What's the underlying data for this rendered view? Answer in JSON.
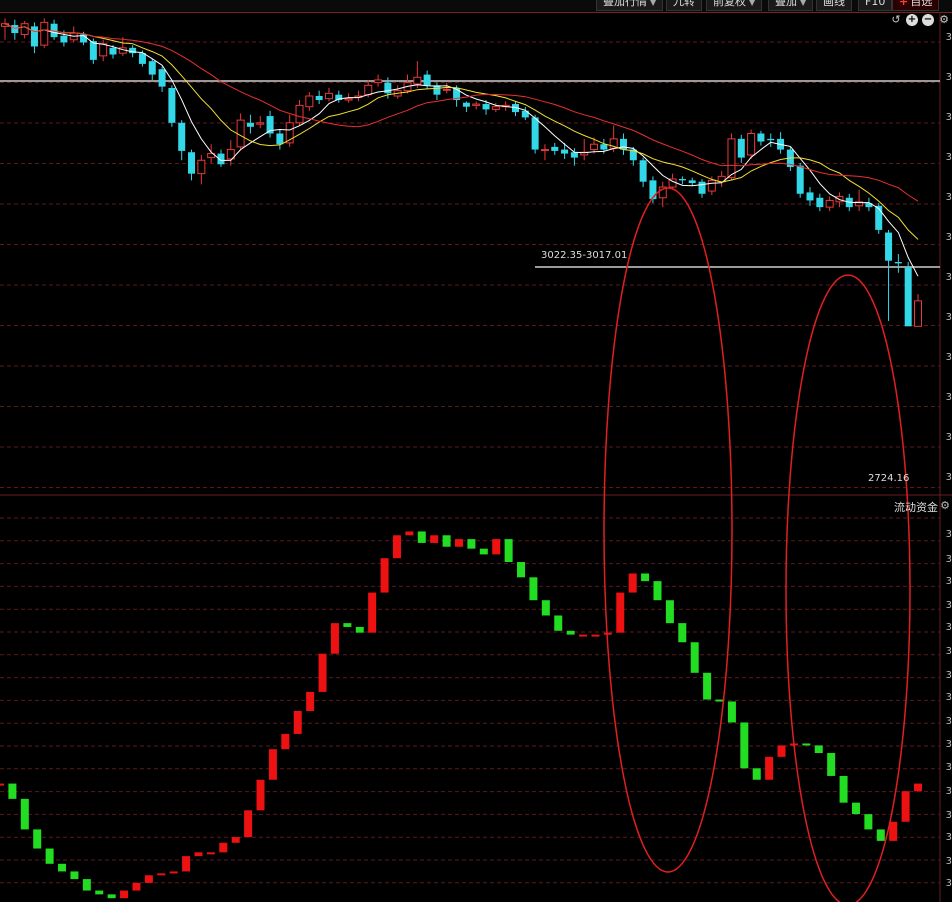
{
  "toolbar": {
    "items": [
      {
        "label": "叠加行情",
        "caret": true
      },
      {
        "label": "九转",
        "caret": false
      },
      {
        "label": "前复权",
        "caret": true
      },
      {
        "label": "叠加",
        "caret": true
      },
      {
        "label": "画线",
        "caret": false
      },
      {
        "label": "F10",
        "caret": false
      },
      {
        "label": "自选",
        "caret": false
      }
    ],
    "fav_plus": "+"
  },
  "chart_tools": {
    "undo": "↺",
    "zoom_in": "+",
    "zoom_out": "−",
    "settings": "⚙"
  },
  "annotations": {
    "range_label": "3022.35-3017.01",
    "low_label": "2724.16"
  },
  "lower_panel": {
    "title": "流动资金",
    "settings": "⚙"
  },
  "axis_tick_glyph": "3",
  "colors": {
    "up": "#e8393a",
    "down": "#33d8e8",
    "ma5": "#ffffff",
    "ma10": "#f2e030",
    "ma20": "#e83030",
    "flow_up": "#ee1111",
    "flow_down": "#22dd22",
    "grid": "#5a1a1a",
    "hline": "#9a9a9a",
    "ellipse": "#e02020"
  },
  "chart_data": [
    {
      "type": "candlestick",
      "title": "",
      "candles": [
        [
          3050,
          3052,
          3040,
          3056
        ],
        [
          3051,
          3045,
          3040,
          3055
        ],
        [
          3044,
          3052,
          3041,
          3054
        ],
        [
          3050,
          3035,
          3030,
          3053
        ],
        [
          3036,
          3053,
          3034,
          3056
        ],
        [
          3052,
          3042,
          3040,
          3055
        ],
        [
          3043,
          3038,
          3035,
          3047
        ],
        [
          3040,
          3045,
          3038,
          3050
        ],
        [
          3044,
          3038,
          3036,
          3046
        ],
        [
          3039,
          3025,
          3022,
          3041
        ],
        [
          3028,
          3037,
          3024,
          3040
        ],
        [
          3034,
          3029,
          3026,
          3036
        ],
        [
          3030,
          3034,
          3028,
          3042
        ],
        [
          3034,
          3030,
          3027,
          3036
        ],
        [
          3030,
          3022,
          3020,
          3032
        ],
        [
          3024,
          3014,
          3010,
          3026
        ],
        [
          3018,
          3005,
          3001,
          3020
        ],
        [
          3004,
          2978,
          2975,
          3006
        ],
        [
          2978,
          2957,
          2950,
          2980
        ],
        [
          2956,
          2940,
          2935,
          2958
        ],
        [
          2940,
          2950,
          2932,
          2954
        ],
        [
          2952,
          2955,
          2948,
          2962
        ],
        [
          2955,
          2947,
          2945,
          2958
        ],
        [
          2951,
          2958,
          2946,
          2965
        ],
        [
          2960,
          2980,
          2958,
          2985
        ],
        [
          2978,
          2975,
          2970,
          2984
        ],
        [
          2977,
          2978,
          2974,
          2983
        ],
        [
          2983,
          2970,
          2967,
          2987
        ],
        [
          2970,
          2962,
          2958,
          2973
        ],
        [
          2963,
          2978,
          2960,
          2984
        ],
        [
          2978,
          2991,
          2976,
          2995
        ],
        [
          2990,
          2998,
          2987,
          3001
        ],
        [
          2998,
          2995,
          2992,
          3002
        ],
        [
          2996,
          3000,
          2994,
          3004
        ],
        [
          2999,
          2995,
          2993,
          3002
        ],
        [
          2995,
          2996,
          2993,
          3000
        ],
        [
          2997,
          2998,
          2994,
          3002
        ],
        [
          2999,
          3006,
          2997,
          3010
        ],
        [
          3008,
          3010,
          3005,
          3014
        ],
        [
          3008,
          3000,
          2996,
          3012
        ],
        [
          2998,
          3002,
          2996,
          3006
        ],
        [
          3002,
          3008,
          3000,
          3014
        ],
        [
          3007,
          3012,
          3004,
          3024
        ],
        [
          3014,
          3006,
          3003,
          3017
        ],
        [
          3006,
          2999,
          2995,
          3008
        ],
        [
          3003,
          3003,
          3000,
          3008
        ],
        [
          3004,
          2995,
          2990,
          3006
        ],
        [
          2993,
          2990,
          2986,
          2994
        ],
        [
          2991,
          2992,
          2988,
          2994
        ],
        [
          2992,
          2988,
          2984,
          2995
        ],
        [
          2988,
          2990,
          2986,
          2993
        ],
        [
          2990,
          2991,
          2987,
          2994
        ],
        [
          2992,
          2986,
          2983,
          2994
        ],
        [
          2987,
          2982,
          2980,
          2990
        ],
        [
          2982,
          2958,
          2955,
          2984
        ],
        [
          2958,
          2958,
          2950,
          2962
        ],
        [
          2960,
          2957,
          2954,
          2963
        ],
        [
          2958,
          2955,
          2951,
          2963
        ],
        [
          2956,
          2952,
          2946,
          2959
        ],
        [
          2954,
          2956,
          2950,
          2966
        ],
        [
          2958,
          2962,
          2955,
          2967
        ],
        [
          2962,
          2958,
          2955,
          2966
        ],
        [
          2959,
          2966,
          2956,
          2976
        ],
        [
          2966,
          2958,
          2954,
          2970
        ],
        [
          2958,
          2950,
          2946,
          2960
        ],
        [
          2950,
          2934,
          2930,
          2952
        ],
        [
          2935,
          2921,
          2918,
          2938
        ],
        [
          2922,
          2930,
          2915,
          2934
        ],
        [
          2930,
          2936,
          2928,
          2940
        ],
        [
          2936,
          2935,
          2932,
          2938
        ],
        [
          2935,
          2933,
          2931,
          2937
        ],
        [
          2934,
          2925,
          2922,
          2936
        ],
        [
          2927,
          2935,
          2924,
          2938
        ],
        [
          2934,
          2938,
          2930,
          2942
        ],
        [
          2937,
          2966,
          2935,
          2970
        ],
        [
          2966,
          2952,
          2948,
          2969
        ],
        [
          2954,
          2970,
          2951,
          2973
        ],
        [
          2970,
          2964,
          2961,
          2972
        ],
        [
          2966,
          2965,
          2960,
          2970
        ],
        [
          2966,
          2958,
          2955,
          2971
        ],
        [
          2958,
          2945,
          2942,
          2960
        ],
        [
          2946,
          2925,
          2922,
          2948
        ],
        [
          2926,
          2920,
          2916,
          2930
        ],
        [
          2922,
          2915,
          2912,
          2925
        ],
        [
          2915,
          2920,
          2912,
          2923
        ],
        [
          2919,
          2923,
          2915,
          2926
        ],
        [
          2922,
          2915,
          2912,
          2925
        ],
        [
          2916,
          2919,
          2912,
          2928
        ],
        [
          2918,
          2915,
          2912,
          2922
        ],
        [
          2916,
          2898,
          2895,
          2918
        ],
        [
          2896,
          2875,
          2830,
          2898
        ],
        [
          2874,
          2873,
          2866,
          2880
        ],
        [
          2870,
          2826,
          2826,
          2874
        ],
        [
          2826,
          2845,
          2826,
          2850
        ]
      ],
      "price_ylim": [
        2700,
        3060
      ]
    },
    {
      "type": "bar",
      "title": "",
      "values": [
        12,
        4,
        -12,
        -22,
        -30,
        -34,
        -38,
        -44,
        -46,
        -48,
        -44,
        -40,
        -36,
        -35,
        -34,
        -26,
        -24,
        -24,
        -19,
        -16,
        -2,
        14,
        30,
        38,
        50,
        60,
        80,
        96,
        94,
        91,
        112,
        130,
        142,
        144,
        138,
        142,
        136,
        140,
        135,
        132,
        140,
        128,
        120,
        108,
        100,
        92,
        90,
        90,
        90,
        91,
        112,
        122,
        118,
        108,
        96,
        86,
        70,
        56,
        55,
        44,
        20,
        14,
        26,
        32,
        33,
        32,
        28,
        16,
        2,
        -4,
        -12,
        -18,
        -8,
        8,
        12
      ],
      "ylim": [
        -50,
        150
      ]
    }
  ]
}
